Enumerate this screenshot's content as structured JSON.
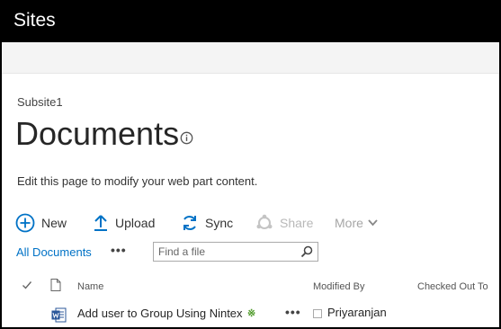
{
  "header": {
    "title": "Sites"
  },
  "breadcrumb": "Subsite1",
  "page": {
    "title": "Documents",
    "edit_hint": "Edit this page to modify your web part content."
  },
  "commands": {
    "new": "New",
    "upload": "Upload",
    "sync": "Sync",
    "share": "Share",
    "more": "More"
  },
  "view": {
    "current": "All Documents",
    "ellipsis": "•••"
  },
  "search": {
    "placeholder": "Find a file"
  },
  "columns": {
    "name": "Name",
    "modified_by": "Modified By",
    "checked_out_to": "Checked Out To"
  },
  "rows": [
    {
      "icon": "word-doc-icon",
      "name": "Add user to Group Using Nintex",
      "new_badge": "※",
      "ellipsis": "•••",
      "modified_by": "Priyaranjan"
    }
  ],
  "colors": {
    "suite_bar": "#000000",
    "link": "#0072c6",
    "command_icon": "#0072c6",
    "disabled": "#b8b8b8",
    "new_badge": "#4f9a2a"
  }
}
